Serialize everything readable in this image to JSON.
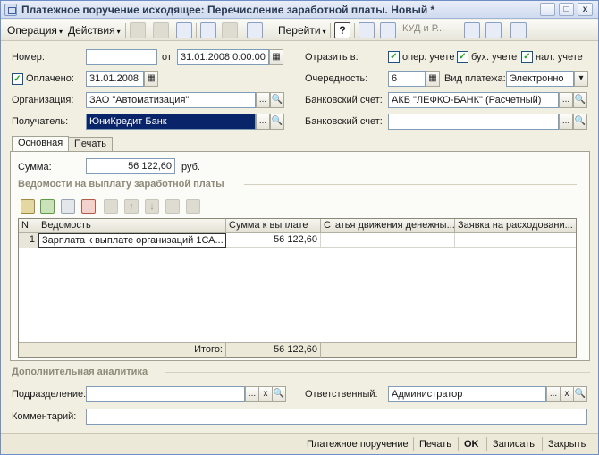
{
  "window": {
    "title": "Платежное поручение исходящее: Перечисление заработной платы. Новый *"
  },
  "titlebar_buttons": {
    "minimize": "_",
    "maximize": "□",
    "close": "x"
  },
  "toolbar": {
    "operation_label": "Операция",
    "actions_label": "Действия",
    "goto_label": "Перейти",
    "help_label": "?",
    "kud_label": "КУД и Р...",
    "dropdown_arrow": "▾"
  },
  "form": {
    "number_label": "Номер:",
    "number_value": "",
    "from_label": "от",
    "date_value": "31.01.2008  0:00:00",
    "paid_label": "Оплачено:",
    "paid_checked": true,
    "paid_date": "31.01.2008",
    "org_label": "Организация:",
    "org_value": "ЗАО \"Автоматизация\"",
    "recipient_label": "Получатель:",
    "recipient_value": "ЮниКредит Банк",
    "reflect_label": "Отразить в:",
    "oper_label": "опер. учете",
    "buh_label": "бух. учете",
    "nal_label": "нал. учете",
    "priority_label": "Очередность:",
    "priority_value": "6",
    "payment_type_label": "Вид платежа:",
    "payment_type_value": "Электронно",
    "bank_account_label": "Банковский счет:",
    "bank_account_value": "АКБ \"ЛЕФКО-БАНК\" (Расчетный)",
    "bank_account2_label": "Банковский счет:",
    "bank_account2_value": "",
    "ellipsis": "...",
    "search": "🔍",
    "clear": "x",
    "check_mark": "✓"
  },
  "tabs": [
    {
      "label": "Основная",
      "active": true
    },
    {
      "label": "Печать",
      "active": false
    }
  ],
  "main": {
    "sum_label": "Сумма:",
    "sum_value": "56 122,60",
    "currency": "руб.",
    "statements_title": "Ведомости на выплату заработной платы"
  },
  "grid": {
    "columns": [
      "N",
      "Ведомость",
      "Сумма к выплате",
      "Статья движения денежны...",
      "Заявка на расходовани..."
    ],
    "rows": [
      {
        "n": "1",
        "statement": "Зарплата к выплате организаций 1СА...",
        "amount": "56 122,60",
        "article": "",
        "request": ""
      }
    ],
    "total_label": "Итого:",
    "total_value": "56 122,60"
  },
  "analytics": {
    "title": "Дополнительная аналитика",
    "department_label": "Подразделение:",
    "department_value": "",
    "responsible_label": "Ответственный:",
    "responsible_value": "Администратор",
    "comment_label": "Комментарий:",
    "comment_value": ""
  },
  "bottom": {
    "payment_order": "Платежное поручение",
    "print": "Печать",
    "ok": "OK",
    "save": "Записать",
    "close": "Закрыть"
  }
}
